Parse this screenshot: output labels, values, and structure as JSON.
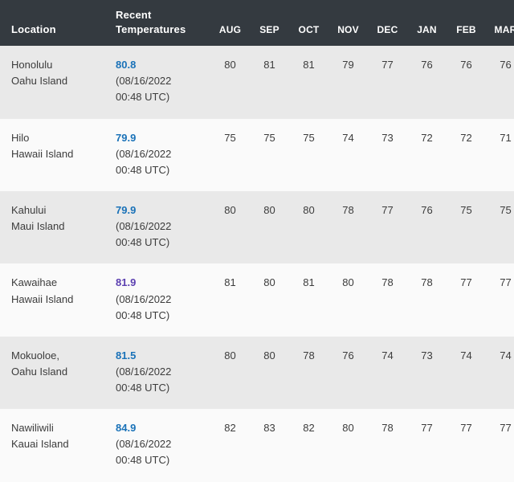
{
  "table": {
    "columns": {
      "location_label": "Location",
      "recent_label_line1": "Recent",
      "recent_label_line2": "Temperatures",
      "months": [
        "AUG",
        "SEP",
        "OCT",
        "NOV",
        "DEC",
        "JAN",
        "FEB",
        "MAR"
      ]
    },
    "colors": {
      "header_background": "#343a40",
      "header_text": "#ffffff",
      "row_odd_background": "#e9e9e9",
      "row_even_background": "#fafafa",
      "link": "#1a72b8",
      "link_visited": "#5b3fb0",
      "body_text": "#3c3c3c"
    },
    "rows": [
      {
        "city": "Honolulu",
        "island": "Oahu Island",
        "recent_value": "80.8",
        "recent_date_line1": "(08/16/2022",
        "recent_date_line2": "00:48 UTC)",
        "visited": false,
        "months": [
          "80",
          "81",
          "81",
          "79",
          "77",
          "76",
          "76",
          "76"
        ]
      },
      {
        "city": "Hilo",
        "island": "Hawaii Island",
        "recent_value": "79.9",
        "recent_date_line1": "(08/16/2022",
        "recent_date_line2": "00:48 UTC)",
        "visited": false,
        "months": [
          "75",
          "75",
          "75",
          "74",
          "73",
          "72",
          "72",
          "71"
        ]
      },
      {
        "city": "Kahului",
        "island": "Maui Island",
        "recent_value": "79.9",
        "recent_date_line1": "(08/16/2022",
        "recent_date_line2": "00:48 UTC)",
        "visited": false,
        "months": [
          "80",
          "80",
          "80",
          "78",
          "77",
          "76",
          "75",
          "75"
        ]
      },
      {
        "city": "Kawaihae",
        "island": "Hawaii Island",
        "recent_value": "81.9",
        "recent_date_line1": "(08/16/2022",
        "recent_date_line2": "00:48 UTC)",
        "visited": true,
        "months": [
          "81",
          "80",
          "81",
          "80",
          "78",
          "78",
          "77",
          "77"
        ]
      },
      {
        "city": "Mokuoloe,",
        "island": "Oahu Island",
        "recent_value": "81.5",
        "recent_date_line1": "(08/16/2022",
        "recent_date_line2": "00:48 UTC)",
        "visited": false,
        "months": [
          "80",
          "80",
          "78",
          "76",
          "74",
          "73",
          "74",
          "74"
        ]
      },
      {
        "city": "Nawiliwili",
        "island": "Kauai Island",
        "recent_value": "84.9",
        "recent_date_line1": "(08/16/2022",
        "recent_date_line2": "00:48 UTC)",
        "visited": false,
        "months": [
          "82",
          "83",
          "82",
          "80",
          "78",
          "77",
          "77",
          "77"
        ]
      }
    ]
  }
}
